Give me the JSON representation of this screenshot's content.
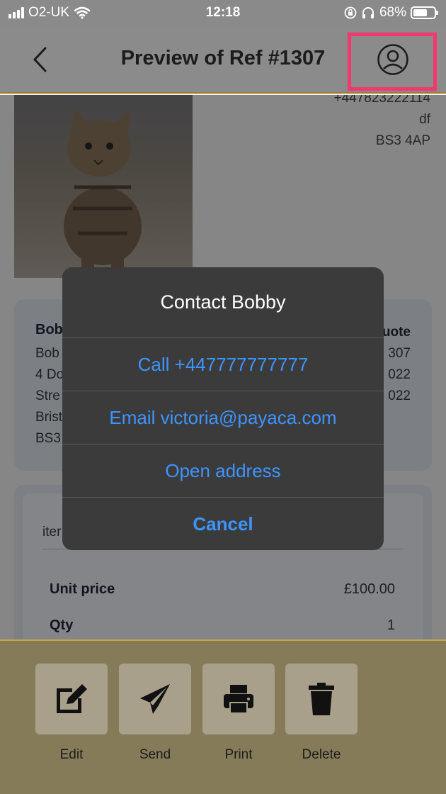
{
  "status_bar": {
    "carrier": "O2-UK",
    "time": "12:18",
    "battery": "68%",
    "battery_level": 0.68
  },
  "header": {
    "title": "Preview of Ref #1307"
  },
  "background": {
    "top_address": [
      "+447823222114",
      "df",
      "BS3 4AP"
    ],
    "customer_name": "Bob",
    "customer_address": [
      "Bob",
      "4 Do",
      "Stre",
      "Brist",
      "BS3"
    ],
    "quote_info": [
      "uote",
      "307",
      "022",
      "022"
    ],
    "line_item_label": "iter",
    "rows": [
      {
        "label": "Unit price",
        "value": "£100.00"
      },
      {
        "label": "Qty",
        "value": "1"
      }
    ]
  },
  "dialog": {
    "title": "Contact Bobby",
    "options": [
      "Call +447777777777",
      "Email victoria@payaca.com",
      "Open address"
    ],
    "cancel": "Cancel"
  },
  "toolbar": {
    "edit": "Edit",
    "send": "Send",
    "print": "Print",
    "delete": "Delete"
  },
  "colors": {
    "accent_link": "#3d95ff",
    "highlight": "#f2386e"
  }
}
